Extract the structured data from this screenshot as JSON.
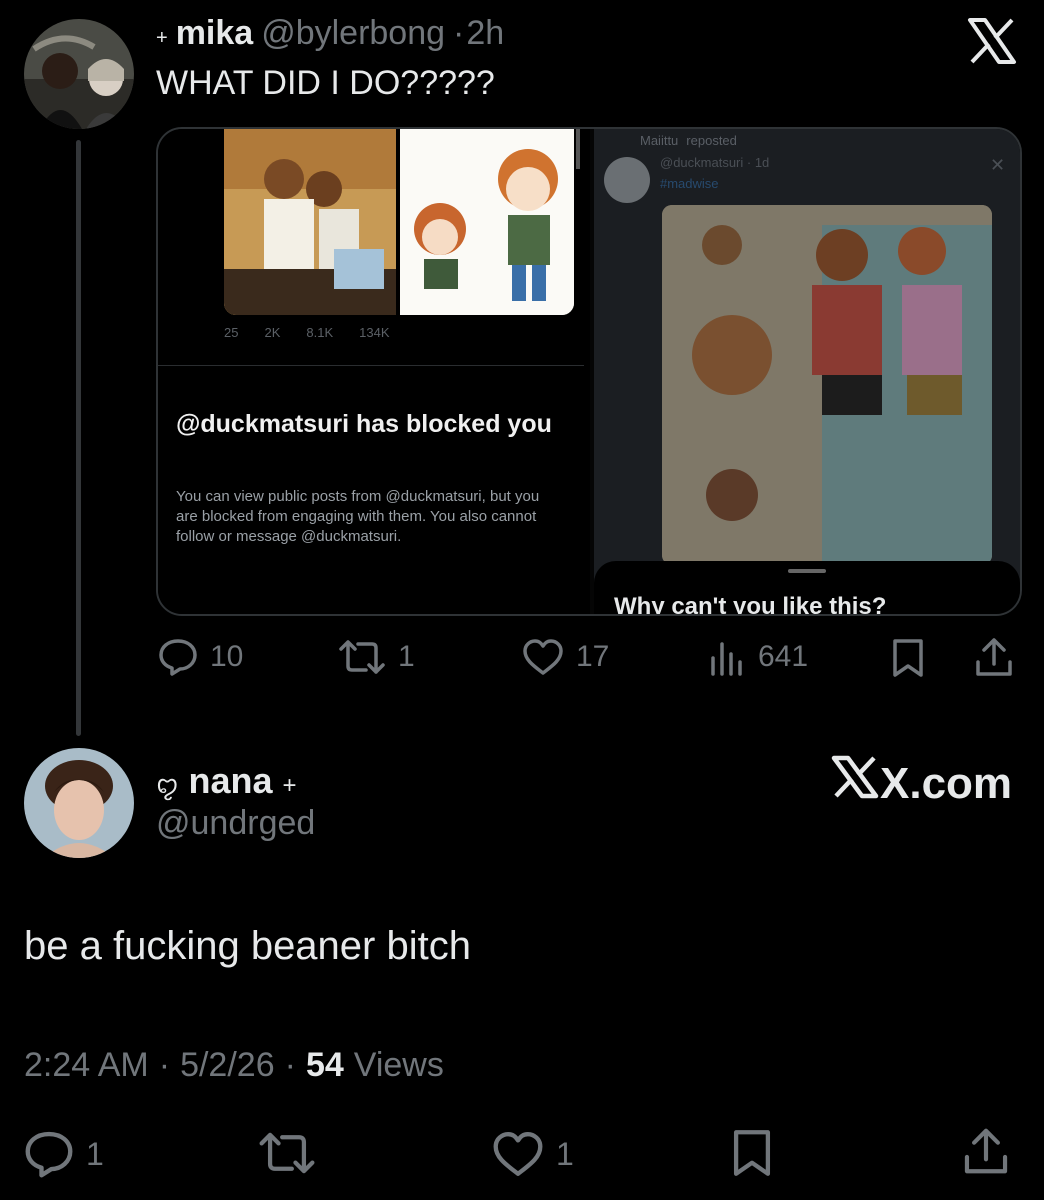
{
  "tweet1": {
    "prefix": "+",
    "name": "mika",
    "handle": "@bylerbong",
    "sep": "·",
    "time": "2h",
    "text": "WHAT DID I DO?????",
    "embed": {
      "left_stats": [
        "25",
        "2K",
        "8.1K",
        "134K"
      ],
      "block_title": "@duckmatsuri has blocked you",
      "block_body": "You can view public posts from @duckmatsuri, but you are blocked from engaging with them. You also cannot follow or message @duckmatsuri.",
      "repost_line": "Maiittu",
      "repost_suffix": "reposted",
      "inner_handle": "@duckmatsuri · 1d",
      "hashtag": "#madwise",
      "sheet_text": "Why can't you like this?"
    },
    "actions": {
      "replies": "10",
      "reposts": "1",
      "likes": "17",
      "views": "641"
    }
  },
  "tweet2": {
    "prefix": "ꨄ",
    "name": "nana",
    "suffix": "+",
    "handle": "@undrged",
    "text": "be a fucking beaner bitch",
    "time": "2:24 AM",
    "sep": "·",
    "date": "5/2/26",
    "views_count": "54",
    "views_label": "Views",
    "actions": {
      "replies": "1",
      "likes": "1"
    }
  },
  "branding": {
    "x_logo_text": "X",
    "watermark": "X.com"
  },
  "colors": {
    "background": "#000000",
    "text": "#e7e9ea",
    "muted": "#71767b",
    "border": "#2f3336"
  }
}
